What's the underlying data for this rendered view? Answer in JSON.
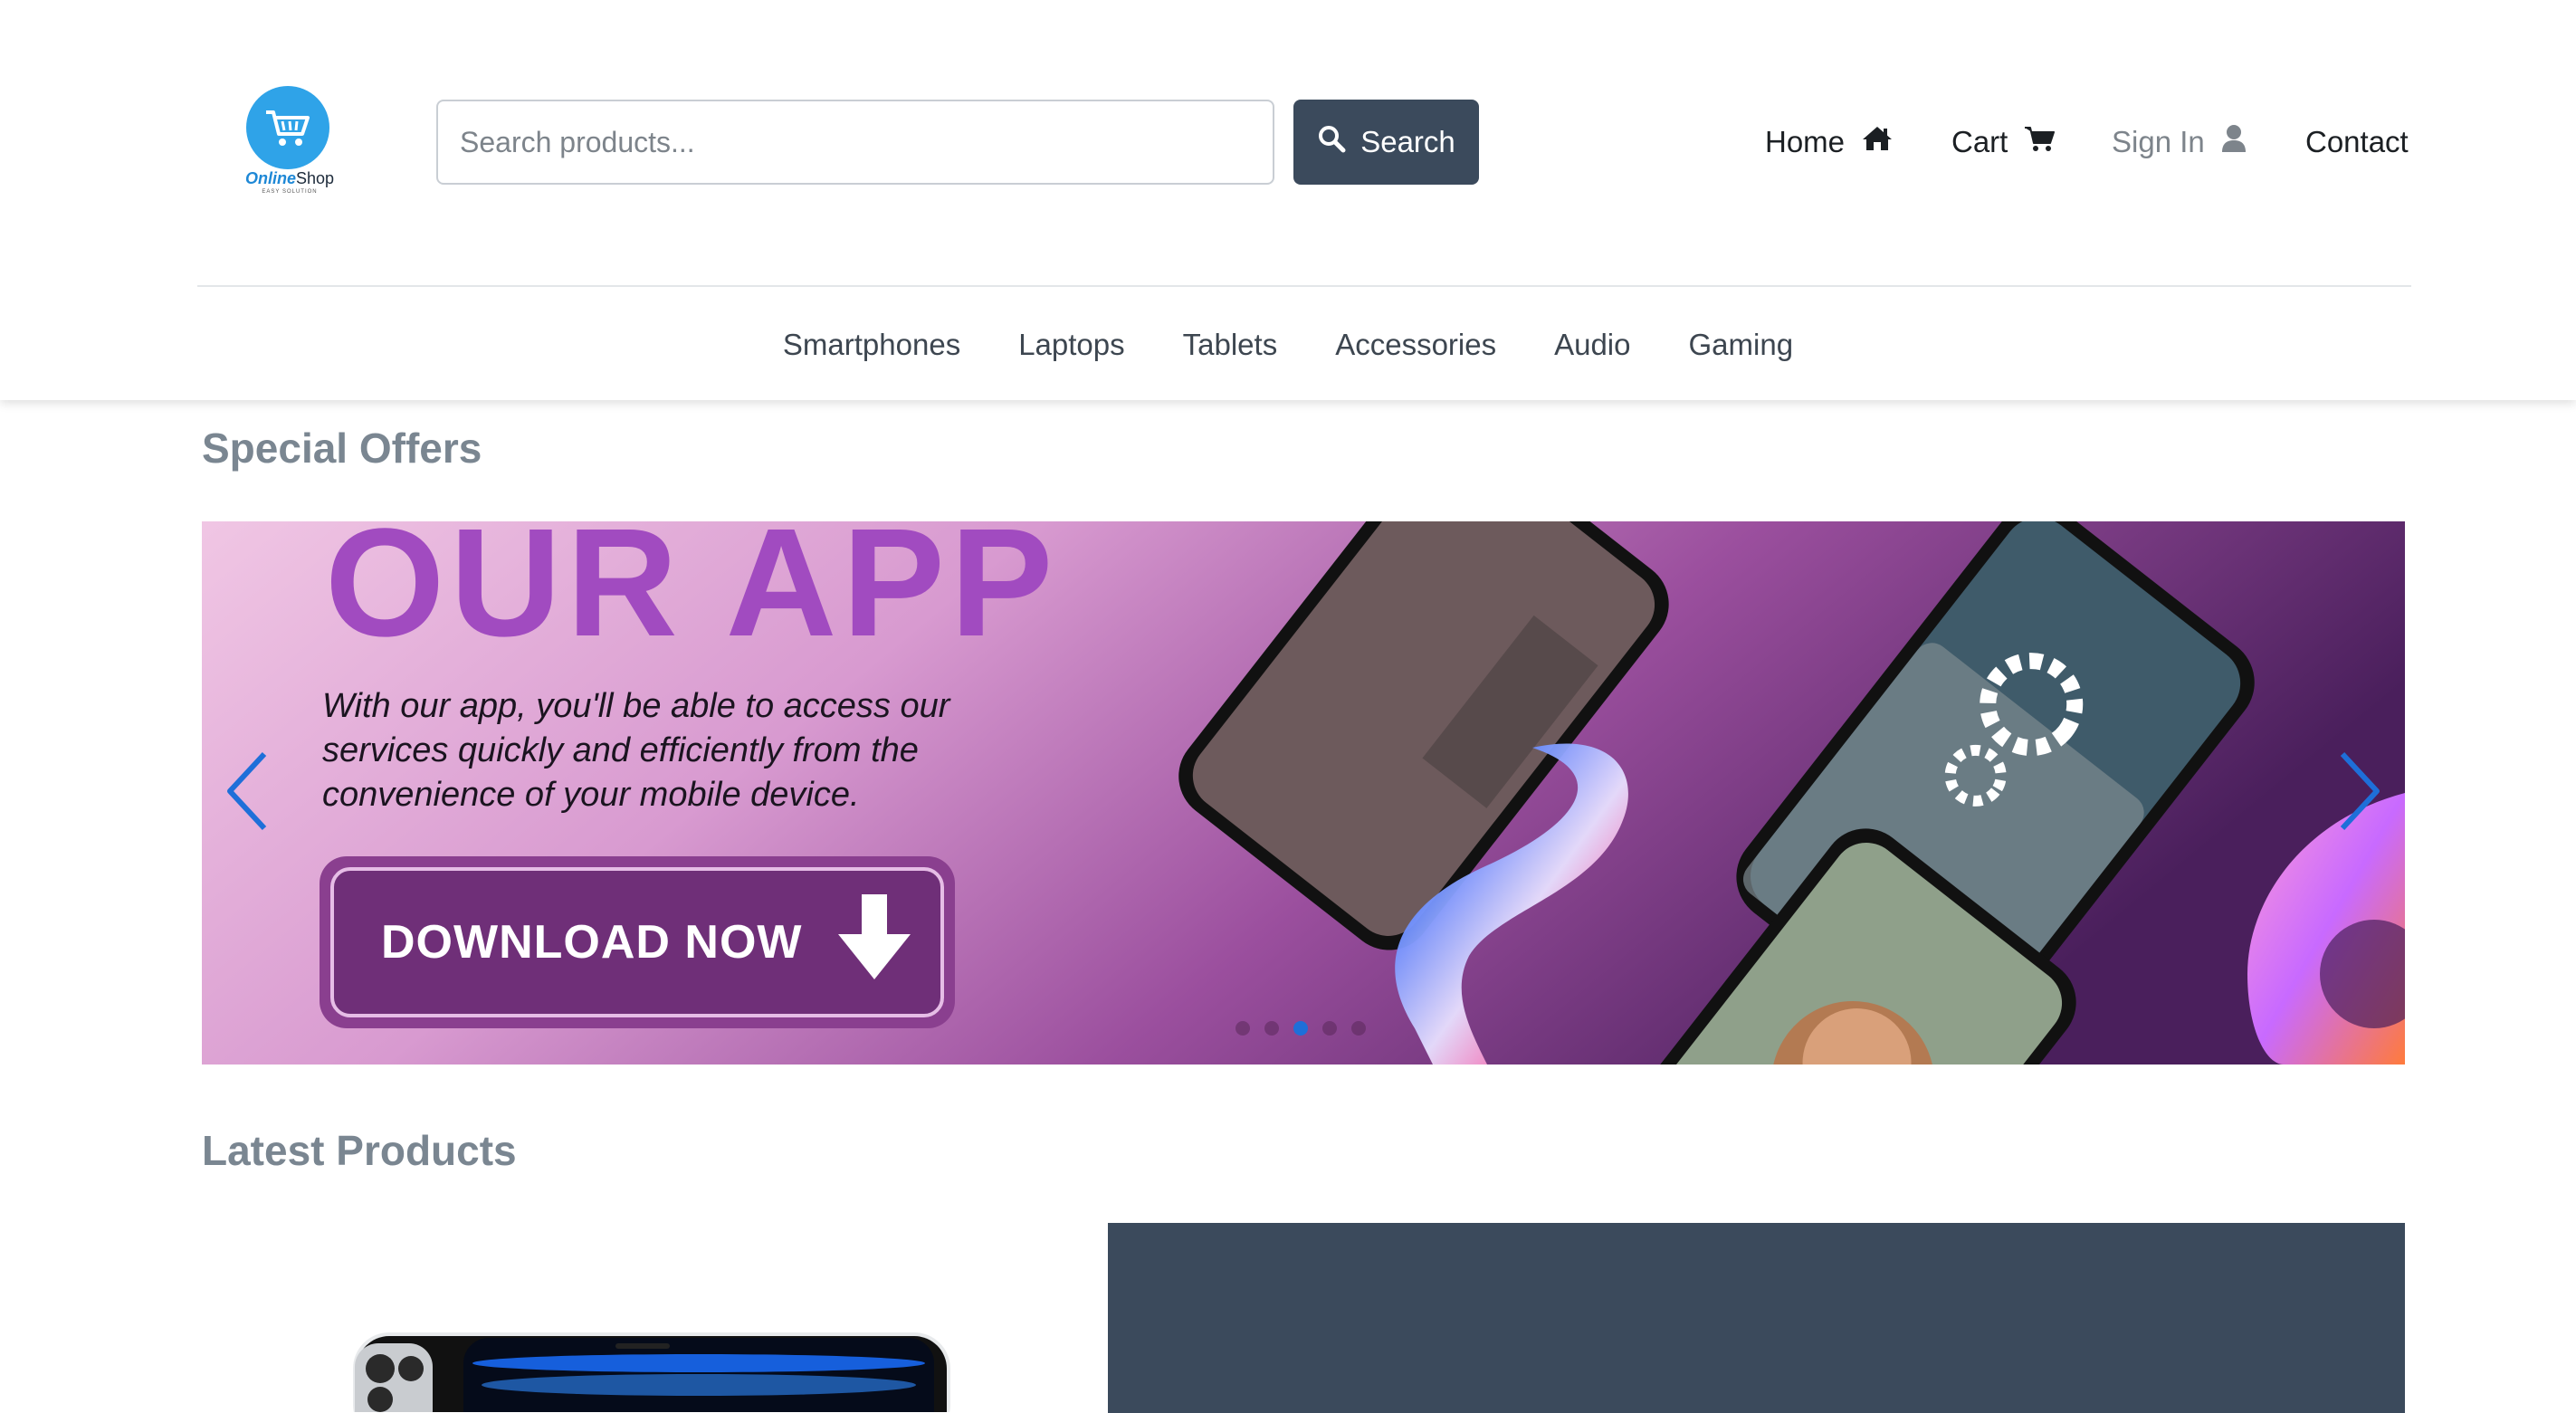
{
  "header": {
    "logo": {
      "brand_part1": "Online",
      "brand_part2": "Shop",
      "tagline": "EASY SOLUTION"
    },
    "search": {
      "placeholder": "Search products...",
      "button_label": "Search"
    },
    "nav": {
      "home": "Home",
      "cart": "Cart",
      "sign_in": "Sign In",
      "contact": "Contact"
    }
  },
  "categories": [
    "Smartphones",
    "Laptops",
    "Tablets",
    "Accessories",
    "Audio",
    "Gaming"
  ],
  "special_offers": {
    "title": "Special Offers",
    "slide": {
      "heading": "OUR APP",
      "body": "With our app, you'll be able to access our services quickly and efficiently from the convenience of your mobile device.",
      "cta": "DOWNLOAD NOW"
    },
    "indicator_count": 5,
    "active_indicator": 3
  },
  "latest_products": {
    "title": "Latest Products"
  },
  "colors": {
    "primary_dark": "#3b4a5c",
    "accent_blue": "#1e6fd9",
    "logo_blue": "#2fa3e8",
    "banner_purple": "#a14bc0",
    "section_title": "#7a8691"
  },
  "icons": [
    "cart-logo-icon",
    "search-icon",
    "home-icon",
    "cart-icon",
    "user-icon",
    "chevron-left-icon",
    "chevron-right-icon",
    "arrow-down-icon"
  ]
}
